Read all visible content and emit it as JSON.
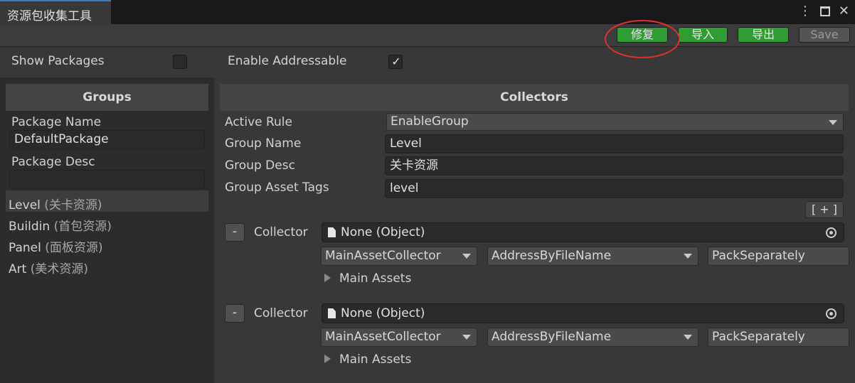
{
  "window": {
    "tab_title": "资源包收集工具"
  },
  "toolbar": {
    "fix_label": "修复",
    "import_label": "导入",
    "export_label": "导出",
    "save_label": "Save"
  },
  "options": {
    "show_packages_label": "Show Packages",
    "show_packages_checked": false,
    "enable_addressable_label": "Enable Addressable",
    "enable_addressable_checked": true
  },
  "groups_panel": {
    "header": "Groups",
    "package_name_label": "Package Name",
    "package_name_value": "DefaultPackage",
    "package_desc_label": "Package Desc",
    "package_desc_value": "",
    "items": [
      {
        "name": "Level",
        "desc": "(关卡资源)",
        "selected": true
      },
      {
        "name": "Buildin",
        "desc": "(首包资源)",
        "selected": false
      },
      {
        "name": "Panel",
        "desc": "(面板资源)",
        "selected": false
      },
      {
        "name": "Art",
        "desc": "(美术资源)",
        "selected": false
      }
    ]
  },
  "collectors_panel": {
    "header": "Collectors",
    "active_rule_label": "Active Rule",
    "active_rule_value": "EnableGroup",
    "group_name_label": "Group Name",
    "group_name_value": "Level",
    "group_desc_label": "Group Desc",
    "group_desc_value": "关卡资源",
    "group_tags_label": "Group Asset Tags",
    "group_tags_value": "level",
    "add_button_label": "[ + ]",
    "collectors": [
      {
        "remove_label": "-",
        "label": "Collector",
        "object_value": "None (Object)",
        "collector_type": "MainAssetCollector",
        "address_rule": "AddressByFileName",
        "pack_rule": "PackSeparately",
        "foldout_label": "Main Assets"
      },
      {
        "remove_label": "-",
        "label": "Collector",
        "object_value": "None (Object)",
        "collector_type": "MainAssetCollector",
        "address_rule": "AddressByFileName",
        "pack_rule": "PackSeparately",
        "foldout_label": "Main Assets"
      }
    ]
  },
  "colors": {
    "accent_green": "#2f9c34",
    "annotation_red": "#e03030",
    "tab_accent": "#3a79bb"
  }
}
